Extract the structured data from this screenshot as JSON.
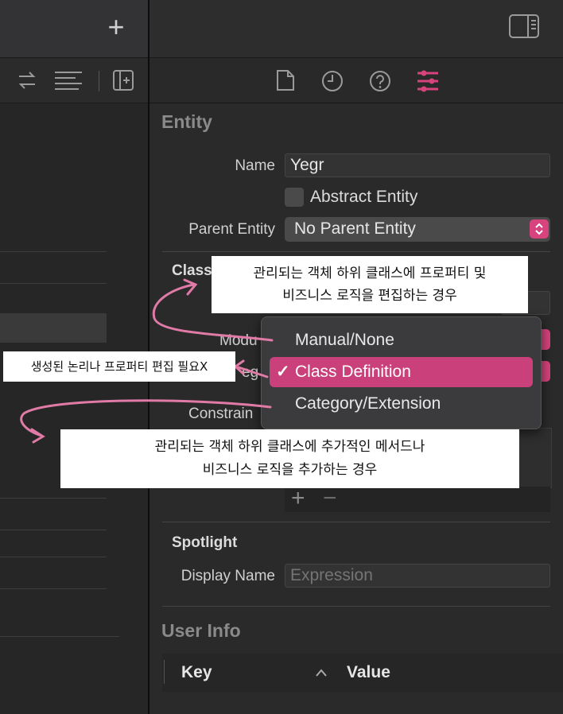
{
  "inspector": {
    "section_entity": "Entity",
    "name_label": "Name",
    "name_value": "Yegr",
    "abstract_label": "Abstract Entity",
    "parent_label": "Parent Entity",
    "parent_value": "No Parent Entity",
    "class_label_partial": "Class",
    "module_label_partial": "Modu",
    "codegen_label_partial": "eg",
    "constraints_label_partial": "Constrain",
    "section_spotlight": "Spotlight",
    "display_name_label": "Display Name",
    "display_name_placeholder": "Expression",
    "section_user_info": "User Info",
    "col_key": "Key",
    "col_value": "Value",
    "add_glyph": "+",
    "remove_glyph": "−"
  },
  "toolbar": {
    "add_glyph": "+"
  },
  "menu": {
    "items": [
      "Manual/None",
      "Class Definition",
      "Category/Extension"
    ],
    "selected_index": 1,
    "check": "✓"
  },
  "annotations": {
    "note_top_line1": "관리되는 객체 하위 클래스에 프로퍼티 및",
    "note_top_line2": "비즈니스 로직을  편집하는 경우",
    "note_left": "생성된 논리나 프로퍼티 편집 필요X",
    "note_bottom_line1": "관리되는 객체 하위 클래스에 추가적인 메서드나",
    "note_bottom_line2": "비즈니스 로직을  추가하는 경우"
  },
  "colors": {
    "accent": "#d6437d",
    "menu_highlight": "#c9407a",
    "arrow": "#e07aa6"
  }
}
